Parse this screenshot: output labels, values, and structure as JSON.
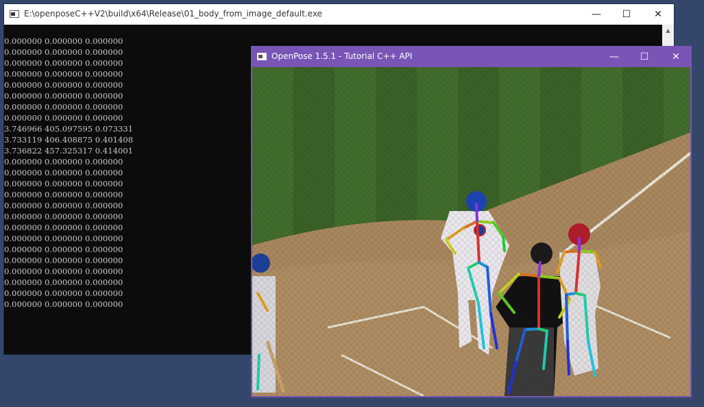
{
  "console": {
    "title": "E:\\openposeC++V2\\build\\x64\\Release\\01_body_from_image_default.exe",
    "lines": [
      "0.000000 0.000000 0.000000",
      "0.000000 0.000000 0.000000",
      "0.000000 0.000000 0.000000",
      "0.000000 0.000000 0.000000",
      "0.000000 0.000000 0.000000",
      "0.000000 0.000000 0.000000",
      "0.000000 0.000000 0.000000",
      "0.000000 0.000000 0.000000",
      "3.746966 405.097595 0.073331",
      "3.733119 406.408875 0.401408",
      "3.736822 457.325317 0.414001",
      "0.000000 0.000000 0.000000",
      "0.000000 0.000000 0.000000",
      "0.000000 0.000000 0.000000",
      "0.000000 0.000000 0.000000",
      "0.000000 0.000000 0.000000",
      "0.000000 0.000000 0.000000",
      "0.000000 0.000000 0.000000",
      "0.000000 0.000000 0.000000",
      "0.000000 0.000000 0.000000",
      "0.000000 0.000000 0.000000",
      "0.000000 0.000000 0.000000",
      "0.000000 0.000000 0.000000",
      "0.000000 0.000000 0.000000",
      "0.000000 0.000000 0.000000"
    ],
    "minimize_icon": "minimize-icon",
    "maximize_icon": "maximize-icon",
    "close_icon": "close-icon"
  },
  "openpose": {
    "title": "OpenPose 1.5.1 - Tutorial C++ API",
    "image": "baseball players with pose skeleton overlay",
    "colors": {
      "titlebar": "#7955b6",
      "grass": "#3f6a2a",
      "dirt": "#a9875e"
    }
  }
}
